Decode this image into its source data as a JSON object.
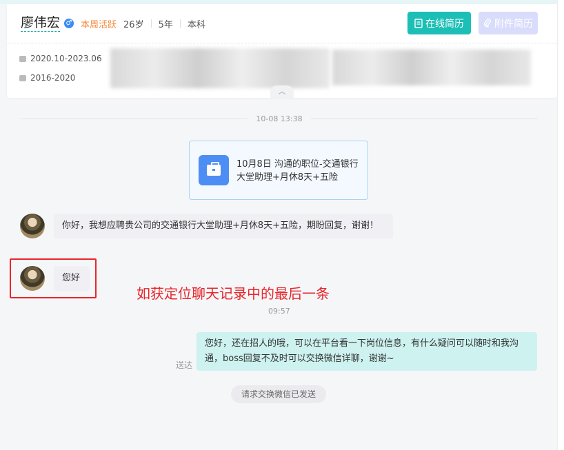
{
  "candidate": {
    "name": "廖伟宏",
    "gender_symbol": "♂",
    "active_tag": "本周活跃",
    "age": "26岁",
    "experience": "5年",
    "education": "本科"
  },
  "buttons": {
    "online_resume": "在线简历",
    "attachment_resume": "附件简历"
  },
  "history": {
    "work_period": "2020.10-2023.06",
    "edu_period": "2016-2020"
  },
  "chat": {
    "time_1": "10-08 13:38",
    "job_card_text": "10月8日 沟通的职位-交通银行大堂助理+月休8天+五险",
    "msg_1": "你好，我想应聘贵公司的交通银行大堂助理+月休8天+五险，期盼回复，谢谢！",
    "msg_2": "您好",
    "annotation": "如获定位聊天记录中的最后一条",
    "time_2": "09:57",
    "reply": "您好，还在招人的哦，可以在平台看一下岗位信息，有什么疑问可以随时和我沟通，boss回复不及时可以交换微信详聊，谢谢~",
    "reply_status": "送达",
    "system_notice": "请求交换微信已发送"
  },
  "colors": {
    "teal": "#1cbfb6",
    "attach_disabled": "#d9dcfb",
    "active_orange": "#f3893b",
    "annotation_red": "#e8262a",
    "job_blue": "#4d8ef5"
  }
}
